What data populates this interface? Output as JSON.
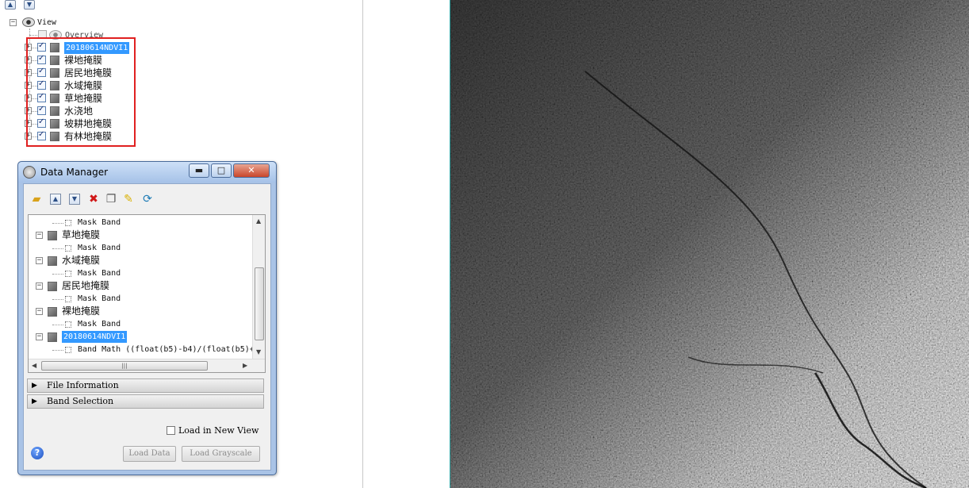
{
  "tree_panel": {
    "up_arrow": "▲",
    "down_arrow": "▼",
    "root_label": "View",
    "overview_label": "Overview",
    "layers": [
      {
        "label": "20180614NDVI1",
        "selected": true
      },
      {
        "label": "裸地掩膜",
        "selected": false
      },
      {
        "label": "居民地掩膜",
        "selected": false
      },
      {
        "label": "水域掩膜",
        "selected": false
      },
      {
        "label": "草地掩膜",
        "selected": false
      },
      {
        "label": "水浇地",
        "selected": false
      },
      {
        "label": "坡耕地掩膜",
        "selected": false
      },
      {
        "label": "有林地掩膜",
        "selected": false
      }
    ]
  },
  "data_manager": {
    "title": "Data Manager",
    "window_buttons": {
      "minimize": "▬",
      "maximize": "□",
      "close": "✕"
    },
    "toolbar_icons": [
      "open-folder-icon",
      "move-up-icon",
      "move-down-icon",
      "close-file-icon",
      "copy-icon",
      "pin-icon",
      "refresh-icon"
    ],
    "tree_rows": [
      {
        "kind": "band",
        "label": "Mask Band"
      },
      {
        "kind": "file",
        "label": "草地掩膜"
      },
      {
        "kind": "band",
        "label": "Mask Band"
      },
      {
        "kind": "file",
        "label": "水域掩膜"
      },
      {
        "kind": "band",
        "label": "Mask Band"
      },
      {
        "kind": "file",
        "label": "居民地掩膜"
      },
      {
        "kind": "band",
        "label": "Mask Band"
      },
      {
        "kind": "file",
        "label": "裸地掩膜"
      },
      {
        "kind": "band",
        "label": "Mask Band"
      },
      {
        "kind": "file",
        "label": "20180614NDVI1"
      },
      {
        "kind": "band",
        "label": "Band Math ((float(b5)-b4)/(float(b5)+"
      }
    ],
    "hscroll_grip": "|||",
    "sections": {
      "file_information": "File Information",
      "band_selection": "Band Selection"
    },
    "load_in_new_view": "Load in New View",
    "load_data": "Load Data",
    "load_grayscale": "Load Grayscale",
    "help": "?"
  },
  "colors": {
    "selection": "#3399ff",
    "highlight_box": "#e02020",
    "viewer_border": "#2aa1a1"
  }
}
